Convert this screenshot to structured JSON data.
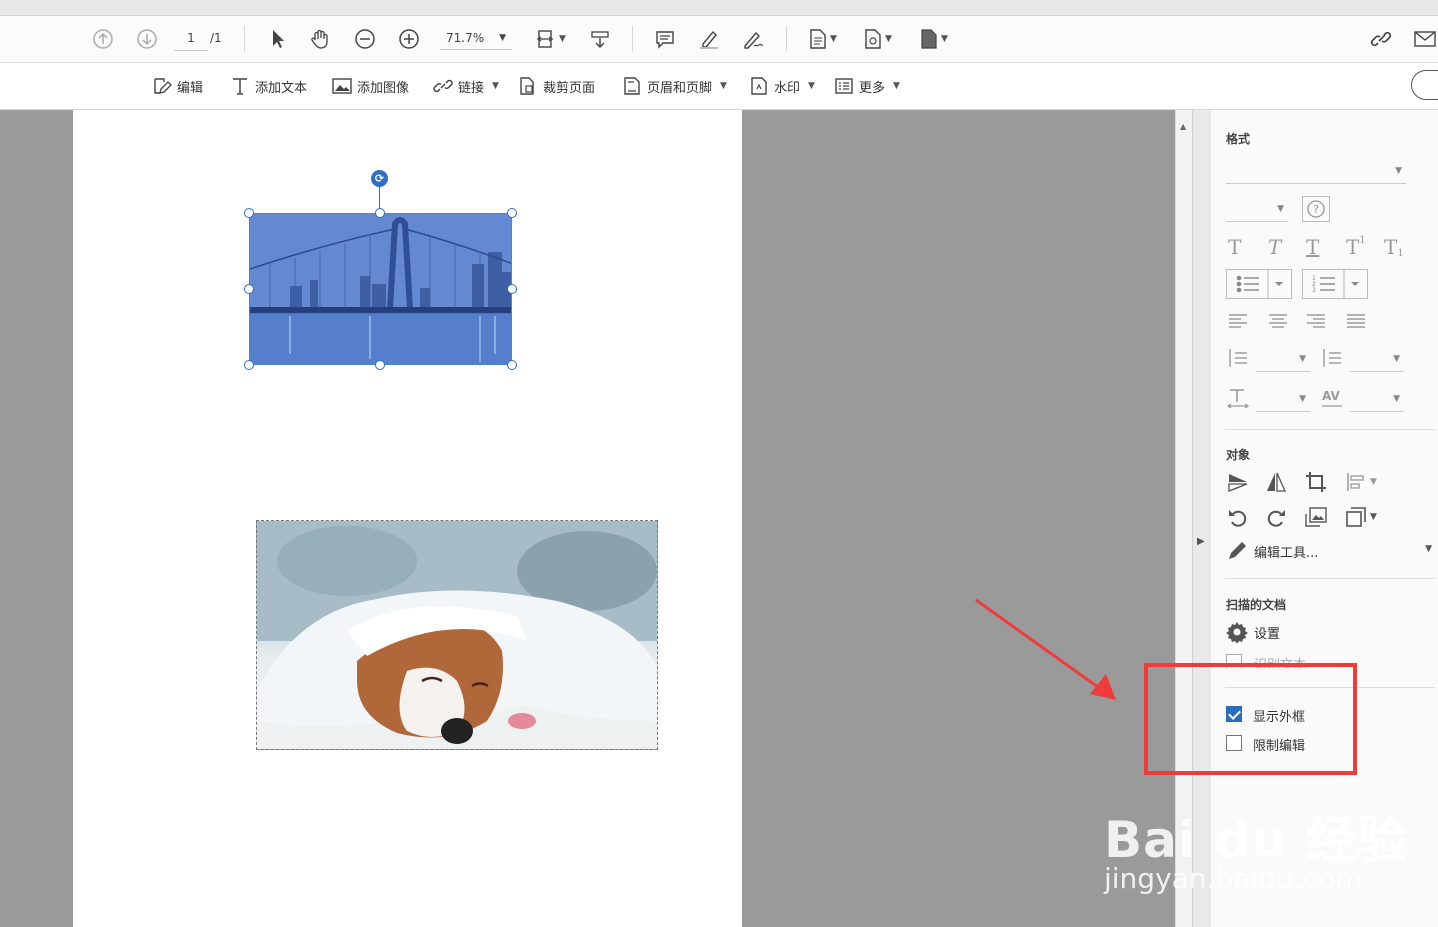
{
  "toolbar1": {
    "page_current": "1",
    "page_total": "/1",
    "zoom": "71.7%"
  },
  "toolbar2": {
    "edit": "编辑",
    "add_text": "添加文本",
    "add_image": "添加图像",
    "link": "链接",
    "crop_page": "裁剪页面",
    "header_footer": "页眉和页脚",
    "watermark": "水印",
    "more": "更多"
  },
  "panel": {
    "format_title": "格式",
    "object_title": "对象",
    "edit_tools": "编辑工具...",
    "scanned_title": "扫描的文档",
    "settings": "设置",
    "recognize_text": "识别文本",
    "show_bbox": "显示外框",
    "restrict_editing": "限制编辑",
    "show_bbox_checked": true,
    "restrict_editing_checked": false
  },
  "watermark": {
    "line1": "Bai du 经验",
    "line2": "jingyan.baidu.com"
  },
  "colors": {
    "accent": "#2a6ebb",
    "highlight": "#ef3b3b"
  }
}
